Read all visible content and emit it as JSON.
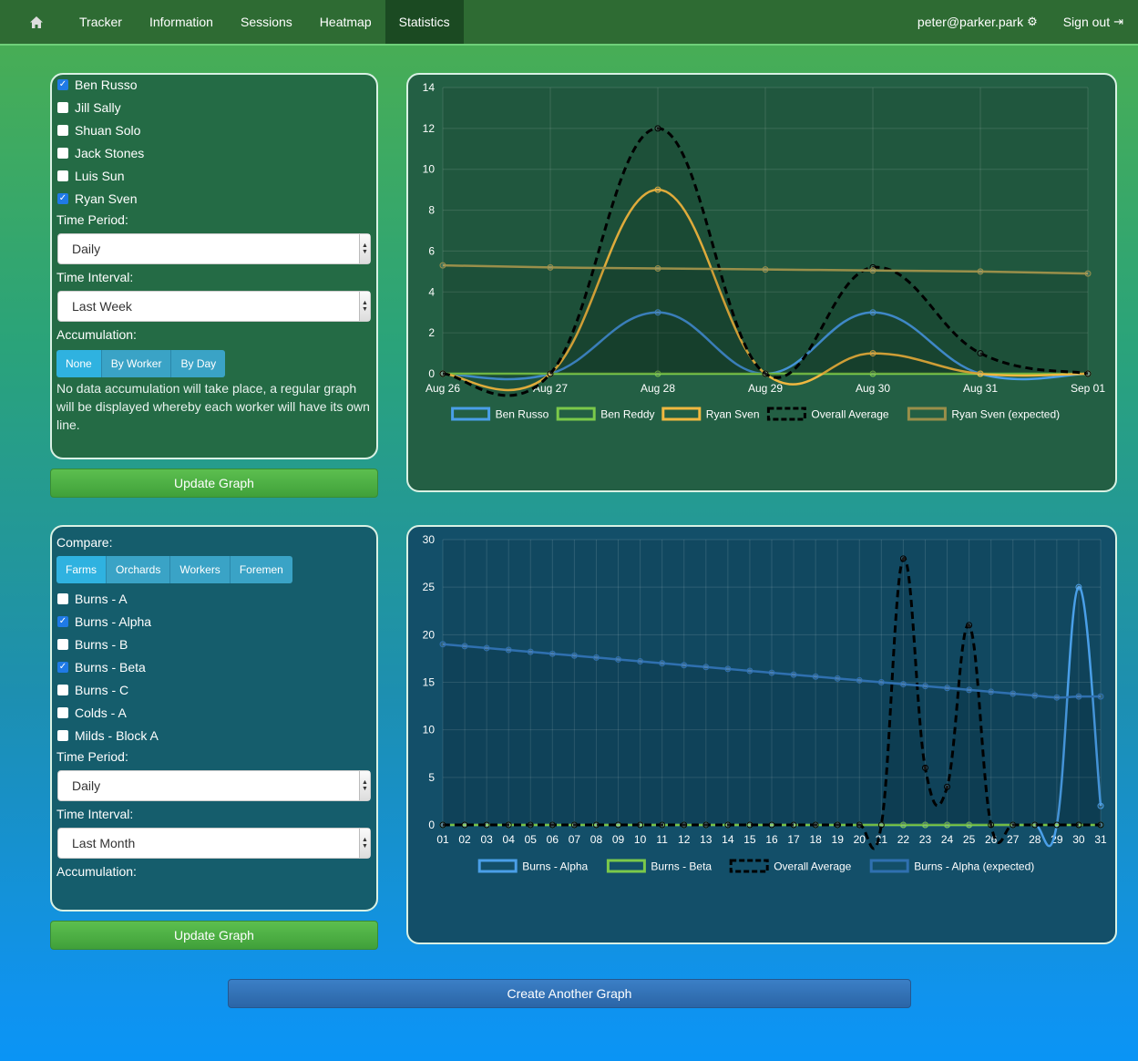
{
  "nav": {
    "items": [
      "Tracker",
      "Information",
      "Sessions",
      "Heatmap",
      "Statistics"
    ],
    "active": "Statistics",
    "user": "peter@parker.park",
    "signout": "Sign out"
  },
  "panel1": {
    "workers": [
      {
        "label": "Ben Russo",
        "checked": true
      },
      {
        "label": "Jill Sally",
        "checked": false
      },
      {
        "label": "Shuan Solo",
        "checked": false
      },
      {
        "label": "Jack Stones",
        "checked": false
      },
      {
        "label": "Luis Sun",
        "checked": false
      },
      {
        "label": "Ryan Sven",
        "checked": true
      }
    ],
    "time_period_label": "Time Period:",
    "time_period_value": "Daily",
    "time_interval_label": "Time Interval:",
    "time_interval_value": "Last Week",
    "accumulation_label": "Accumulation:",
    "accumulation_options": [
      "None",
      "By Worker",
      "By Day"
    ],
    "accumulation_description": "No data accumulation will take place, a regular graph will be displayed whereby each worker will have its own line.",
    "update_label": "Update Graph"
  },
  "panel2": {
    "compare_label": "Compare:",
    "compare_options": [
      "Farms",
      "Orchards",
      "Workers",
      "Foremen"
    ],
    "items": [
      {
        "label": "Burns - A",
        "checked": false
      },
      {
        "label": "Burns - Alpha",
        "checked": true
      },
      {
        "label": "Burns - B",
        "checked": false
      },
      {
        "label": "Burns - Beta",
        "checked": true
      },
      {
        "label": "Burns - C",
        "checked": false
      },
      {
        "label": "Colds - A",
        "checked": false
      },
      {
        "label": "Milds - Block A",
        "checked": false
      }
    ],
    "time_period_label": "Time Period:",
    "time_period_value": "Daily",
    "time_interval_label": "Time Interval:",
    "time_interval_value": "Last Month",
    "accumulation_label": "Accumulation:",
    "update_label": "Update Graph"
  },
  "create_label": "Create Another Graph",
  "chart_data": [
    {
      "type": "line",
      "categories": [
        "Aug 26",
        "Aug 27",
        "Aug 28",
        "Aug 29",
        "Aug 30",
        "Aug 31",
        "Sep 01"
      ],
      "ylim": [
        0,
        14
      ],
      "yticks": [
        0,
        2,
        4,
        6,
        8,
        10,
        12,
        14
      ],
      "grid": true,
      "legend": "bottom",
      "series": [
        {
          "name": "Ben Russo",
          "values": [
            0,
            0,
            3,
            0,
            3,
            0,
            0
          ],
          "color": "#4a9fe8",
          "dash": false
        },
        {
          "name": "Ben Reddy",
          "values": [
            0,
            0,
            0,
            0,
            0,
            0,
            0
          ],
          "color": "#7bc94a",
          "dash": false
        },
        {
          "name": "Ryan Sven",
          "values": [
            0,
            0,
            9,
            0,
            1,
            0,
            0
          ],
          "color": "#f0b840",
          "dash": false
        },
        {
          "name": "Overall Average",
          "values": [
            0,
            0,
            12,
            0,
            5.2,
            1,
            0
          ],
          "color": "#000000",
          "dash": true
        },
        {
          "name": "Ryan Sven (expected)",
          "values": [
            5.3,
            5.2,
            5.15,
            5.1,
            5.05,
            5.0,
            4.9
          ],
          "color": "#9a8f4a",
          "dash": false
        }
      ]
    },
    {
      "type": "line",
      "categories": [
        "01",
        "02",
        "03",
        "04",
        "05",
        "06",
        "07",
        "08",
        "09",
        "10",
        "11",
        "12",
        "13",
        "14",
        "15",
        "16",
        "17",
        "18",
        "19",
        "20",
        "21",
        "22",
        "23",
        "24",
        "25",
        "26",
        "27",
        "28",
        "29",
        "30",
        "31"
      ],
      "ylim": [
        0,
        30
      ],
      "yticks": [
        0,
        5,
        10,
        15,
        20,
        25,
        30
      ],
      "grid": true,
      "legend": "bottom",
      "series": [
        {
          "name": "Burns - Alpha",
          "values": [
            0,
            0,
            0,
            0,
            0,
            0,
            0,
            0,
            0,
            0,
            0,
            0,
            0,
            0,
            0,
            0,
            0,
            0,
            0,
            0,
            0,
            0,
            0,
            0,
            0,
            0,
            0,
            0,
            0,
            25,
            2
          ],
          "color": "#4a9fe8",
          "dash": false
        },
        {
          "name": "Burns - Beta",
          "values": [
            0,
            0,
            0,
            0,
            0,
            0,
            0,
            0,
            0,
            0,
            0,
            0,
            0,
            0,
            0,
            0,
            0,
            0,
            0,
            0,
            0,
            0,
            0,
            0,
            0,
            0,
            0,
            0,
            0,
            0,
            0
          ],
          "color": "#7bc94a",
          "dash": false
        },
        {
          "name": "Overall Average",
          "values": [
            0,
            0,
            0,
            0,
            0,
            0,
            0,
            0,
            0,
            0,
            0,
            0,
            0,
            0,
            0,
            0,
            0,
            0,
            0,
            0,
            0,
            28,
            6,
            4,
            21,
            0,
            0,
            0,
            0,
            0,
            0
          ],
          "color": "#000000",
          "dash": true
        },
        {
          "name": "Burns - Alpha (expected)",
          "values": [
            19,
            18.8,
            18.6,
            18.4,
            18.2,
            18,
            17.8,
            17.6,
            17.4,
            17.2,
            17,
            16.8,
            16.6,
            16.4,
            16.2,
            16,
            15.8,
            15.6,
            15.4,
            15.2,
            15,
            14.8,
            14.6,
            14.4,
            14.2,
            14,
            13.8,
            13.6,
            13.4,
            13.5,
            13.5
          ],
          "color": "#2f70b0",
          "dash": false
        }
      ]
    }
  ]
}
